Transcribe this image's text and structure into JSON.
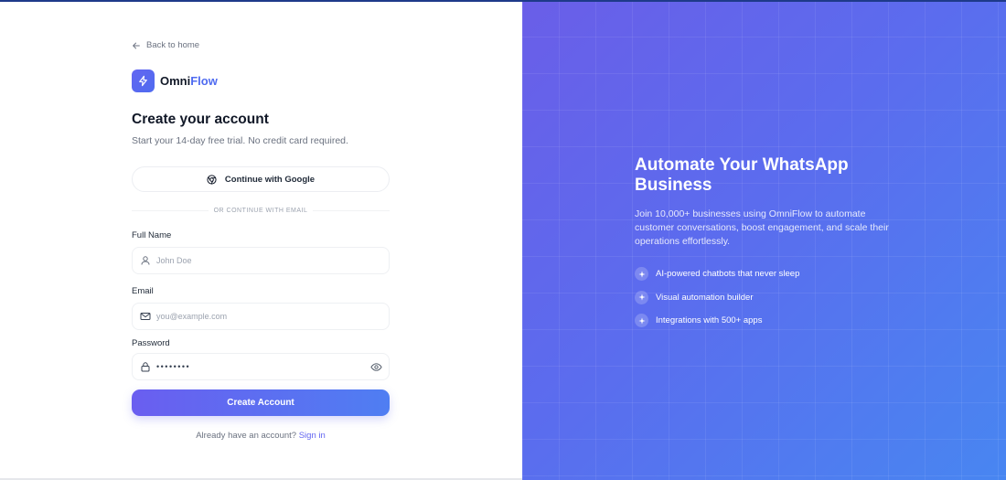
{
  "nav": {
    "back_label": "Back to home"
  },
  "brand": {
    "name_part1": "Omni",
    "name_part2": "Flow"
  },
  "form": {
    "title": "Create your account",
    "subtitle": "Start your 14-day free trial. No credit card required.",
    "google_label": "Continue with Google",
    "divider_text": "OR CONTINUE WITH EMAIL",
    "fields": {
      "name": {
        "label": "Full Name",
        "placeholder": "John Doe",
        "icon": "user-icon"
      },
      "email": {
        "label": "Email",
        "placeholder": "you@example.com",
        "icon": "mail-icon"
      },
      "password": {
        "label": "Password",
        "value": "••••••••",
        "icon": "lock-icon",
        "toggle_icon": "eye-icon"
      }
    },
    "submit_label": "Create Account",
    "signin_prompt": "Already have an account?",
    "signin_link": "Sign in"
  },
  "hero": {
    "title": "Automate Your WhatsApp Business",
    "description": "Join 10,000+ businesses using OmniFlow to automate customer conversations, boost engagement, and scale their operations effortlessly.",
    "features": [
      {
        "label": "AI-powered chatbots that never sleep",
        "icon": "sparkle-icon"
      },
      {
        "label": "Visual automation builder",
        "icon": "sparkle-icon"
      },
      {
        "label": "Integrations with 500+ apps",
        "icon": "sparkle-icon"
      }
    ]
  },
  "colors": {
    "accent": "#6366f1",
    "brand_blue": "#4f6bf0",
    "panel_start": "#6a5ee8",
    "panel_end": "#4886f1"
  }
}
